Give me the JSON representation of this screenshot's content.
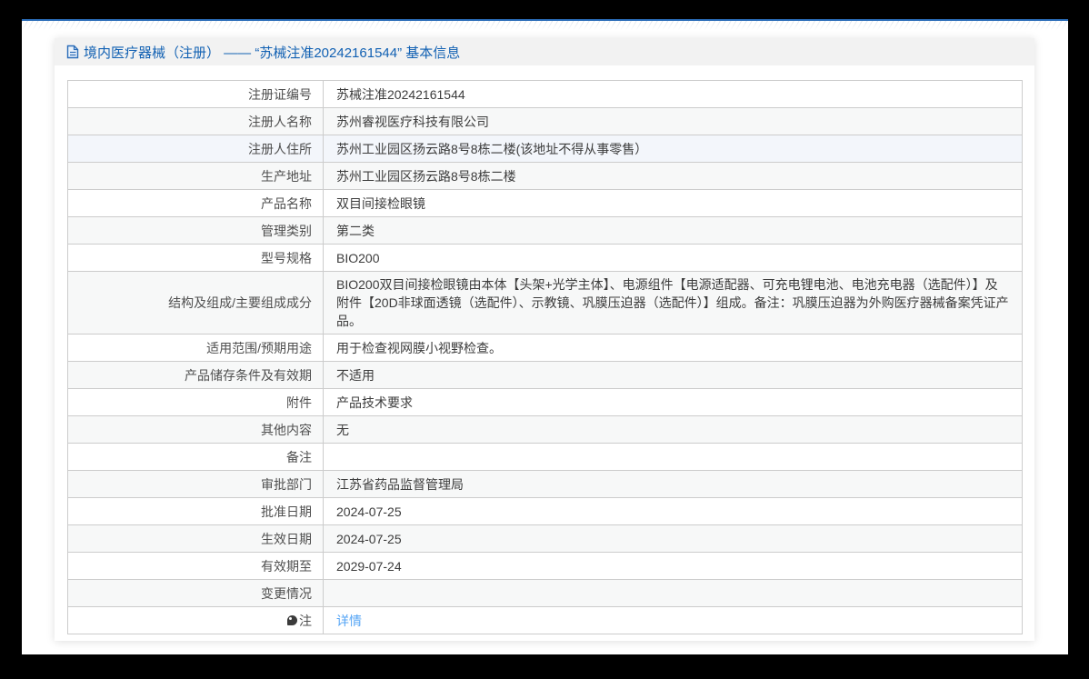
{
  "header": {
    "title": "境内医疗器械（注册） —— “苏械注准20242161544” 基本信息",
    "doc_icon": "document-icon"
  },
  "colors": {
    "accent_blue": "#2a6cb8",
    "title_blue": "#1261b3",
    "link_blue": "#55a5f5",
    "frame_black": "#000000",
    "header_band_gray": "#f2f2f2",
    "table_border_gray": "#cccccc",
    "alt_row_gray": "#f7f8f8",
    "highlight_row_blue": "#f3f6fb"
  },
  "table": {
    "rows": [
      {
        "label": "注册证编号",
        "value": "苏械注准20242161544"
      },
      {
        "label": "注册人名称",
        "value": "苏州睿视医疗科技有限公司"
      },
      {
        "label": "注册人住所",
        "value": "苏州工业园区扬云路8号8栋二楼(该地址不得从事零售）"
      },
      {
        "label": "生产地址",
        "value": "苏州工业园区扬云路8号8栋二楼"
      },
      {
        "label": "产品名称",
        "value": "双目间接检眼镜"
      },
      {
        "label": "管理类别",
        "value": "第二类"
      },
      {
        "label": "型号规格",
        "value": "BIO200"
      },
      {
        "label": "结构及组成/主要组成成分",
        "value": "BIO200双目间接检眼镜由本体【头架+光学主体】、电源组件【电源适配器、可充电锂电池、电池充电器（选配件）】及附件【20D非球面透镜（选配件）、示教镜、巩膜压迫器（选配件）】组成。备注：巩膜压迫器为外购医疗器械备案凭证产品。"
      },
      {
        "label": "适用范围/预期用途",
        "value": "用于检查视网膜小视野检查。"
      },
      {
        "label": "产品储存条件及有效期",
        "value": "不适用"
      },
      {
        "label": "附件",
        "value": "产品技术要求"
      },
      {
        "label": "其他内容",
        "value": "无"
      },
      {
        "label": "备注",
        "value": ""
      },
      {
        "label": "审批部门",
        "value": "江苏省药品监督管理局"
      },
      {
        "label": "批准日期",
        "value": "2024-07-25"
      },
      {
        "label": "生效日期",
        "value": "2024-07-25"
      },
      {
        "label": "有效期至",
        "value": "2029-07-24"
      },
      {
        "label": "变更情况",
        "value": ""
      },
      {
        "label": "注",
        "label_icon": "note-balloon-icon",
        "value": "详情",
        "value_type": "link"
      }
    ]
  }
}
